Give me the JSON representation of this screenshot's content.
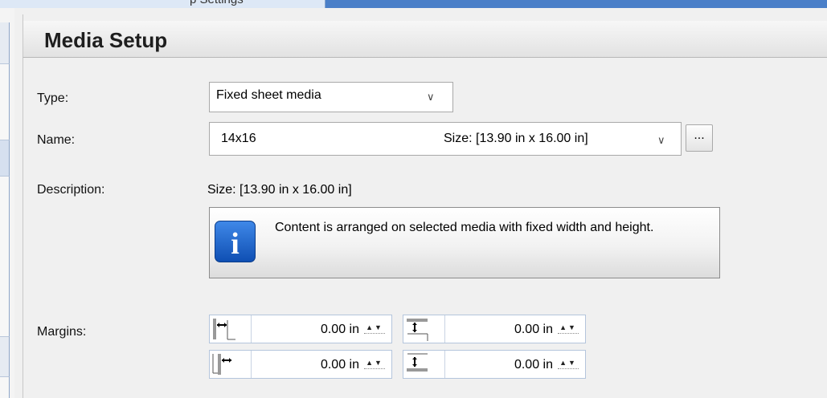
{
  "top_strip": {
    "text": "p Settings"
  },
  "header": {
    "title": "Media Setup"
  },
  "type_field": {
    "label": "Type:",
    "value": "Fixed sheet media"
  },
  "name_field": {
    "label": "Name:",
    "value": "14x16",
    "size_text": "Size: [13.90 in x 16.00 in]",
    "browse_label": "..."
  },
  "description": {
    "label": "Description:",
    "value": "Size: [13.90 in x 16.00 in]"
  },
  "info": {
    "text": "Content is arranged on selected media with fixed width and height.",
    "icon_letter": "i"
  },
  "margins": {
    "label": "Margins:",
    "left": "0.00 in",
    "top": "0.00 in",
    "right": "0.00 in",
    "bottom": "0.00 in"
  },
  "spinner_glyph": "▲▼",
  "chevron_glyph": "∨"
}
